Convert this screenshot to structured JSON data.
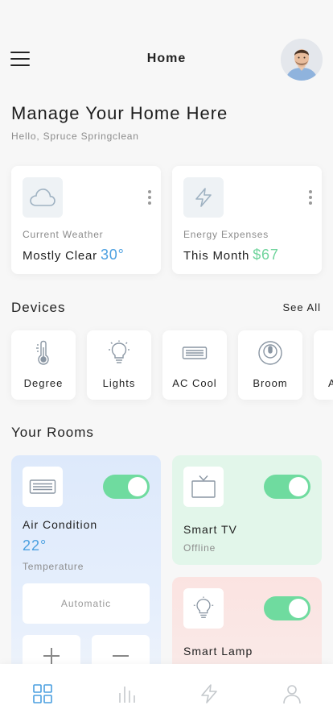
{
  "header": {
    "title": "Home",
    "menu_icon": "hamburger-menu-icon",
    "avatar": "user-avatar"
  },
  "intro": {
    "title": "Manage Your Home Here",
    "greeting": "Hello, Spruce Springclean"
  },
  "stats": [
    {
      "icon": "cloud-icon",
      "label": "Current Weather",
      "value_text": "Mostly Clear",
      "accent_value": "30°",
      "accent_color": "#4a9fe0"
    },
    {
      "icon": "lightning-icon",
      "label": "Energy Expenses",
      "value_text": "This Month",
      "accent_value": "$67",
      "accent_color": "#6fd49c"
    }
  ],
  "devices_section": {
    "title": "Devices",
    "see_all": "See All",
    "items": [
      {
        "label": "Degree",
        "icon": "thermometer-icon"
      },
      {
        "label": "Lights",
        "icon": "lightbulb-icon"
      },
      {
        "label": "AC Cool",
        "icon": "air-conditioner-icon"
      },
      {
        "label": "Broom",
        "icon": "robot-vacuum-icon"
      },
      {
        "label": "A",
        "icon": "device-icon"
      }
    ]
  },
  "rooms_section": {
    "title": "Your Rooms",
    "rooms": [
      {
        "name": "Air Condition",
        "value": "22°",
        "sub": "Temperature",
        "icon": "air-conditioner-icon",
        "on": true,
        "mode": "Automatic",
        "color": "#dde9fb"
      },
      {
        "name": "Smart TV",
        "sub": "Offline",
        "icon": "tv-icon",
        "on": true,
        "color": "#e2f6ea"
      },
      {
        "name": "Smart Lamp",
        "icon": "lightbulb-icon",
        "on": true,
        "color": "#fbe3e1"
      }
    ]
  },
  "tabbar": {
    "tabs": [
      {
        "icon": "grid-icon",
        "active": true
      },
      {
        "icon": "chart-icon",
        "active": false
      },
      {
        "icon": "lightning-icon",
        "active": false
      },
      {
        "icon": "profile-icon",
        "active": false
      }
    ]
  },
  "colors": {
    "accent_blue": "#4a9fe0",
    "accent_green": "#6fd49c",
    "toggle_on": "#6fdb9f"
  }
}
